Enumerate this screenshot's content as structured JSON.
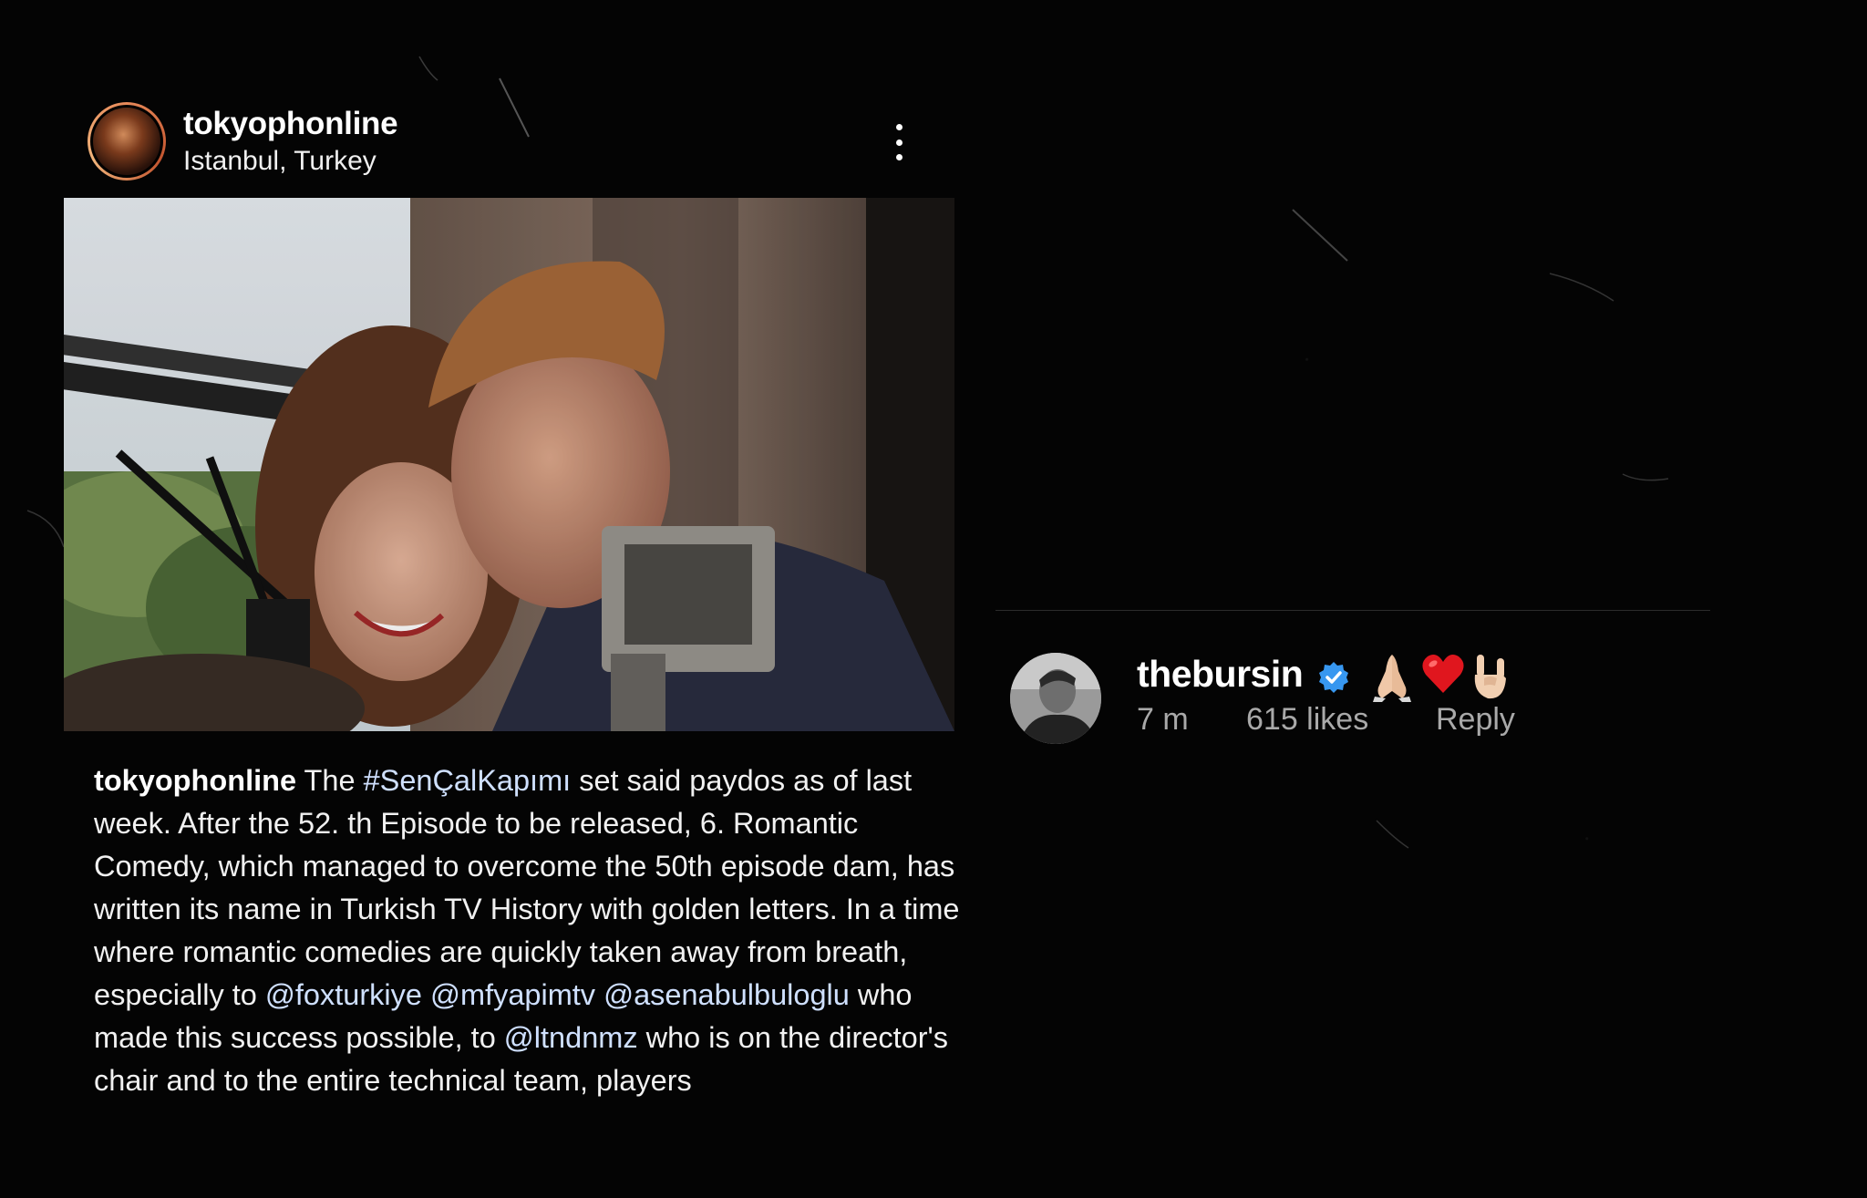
{
  "post": {
    "username": "tokyophonline",
    "location": "Istanbul, Turkey"
  },
  "caption": {
    "username": "tokyophonline",
    "segments": [
      {
        "text": " The ",
        "kind": "plain"
      },
      {
        "text": "#SenÇalKapımı",
        "kind": "tag"
      },
      {
        "text": " set said paydos as of last week. After the 52. th Episode to be released, 6. Romantic Comedy, which managed to overcome the 50th episode dam, has written its name in Turkish TV History with golden letters. In a time where romantic comedies are quickly taken away from breath, especially to ",
        "kind": "plain"
      },
      {
        "text": "@foxturkiye",
        "kind": "tag"
      },
      {
        "text": " ",
        "kind": "plain"
      },
      {
        "text": "@mfyapimtv",
        "kind": "tag"
      },
      {
        "text": " ",
        "kind": "plain"
      },
      {
        "text": "@asenabulbuloglu",
        "kind": "tag"
      },
      {
        "text": " who made this success possible, to ",
        "kind": "plain"
      },
      {
        "text": "@ltndnmz",
        "kind": "tag"
      },
      {
        "text": " who is on the director's chair and to the entire technical team, players",
        "kind": "plain"
      }
    ]
  },
  "comment": {
    "username": "thebursin",
    "verified": true,
    "emojis": [
      "folded-hands",
      "red-heart",
      "sign-of-the-horns"
    ],
    "time": "7 m",
    "likes": "615 likes",
    "reply_label": "Reply"
  },
  "colors": {
    "background": "#040404",
    "verified_badge": "#3797f0",
    "meta_text": "#a9a9a9",
    "avatar_ring": "#e88a5a"
  }
}
